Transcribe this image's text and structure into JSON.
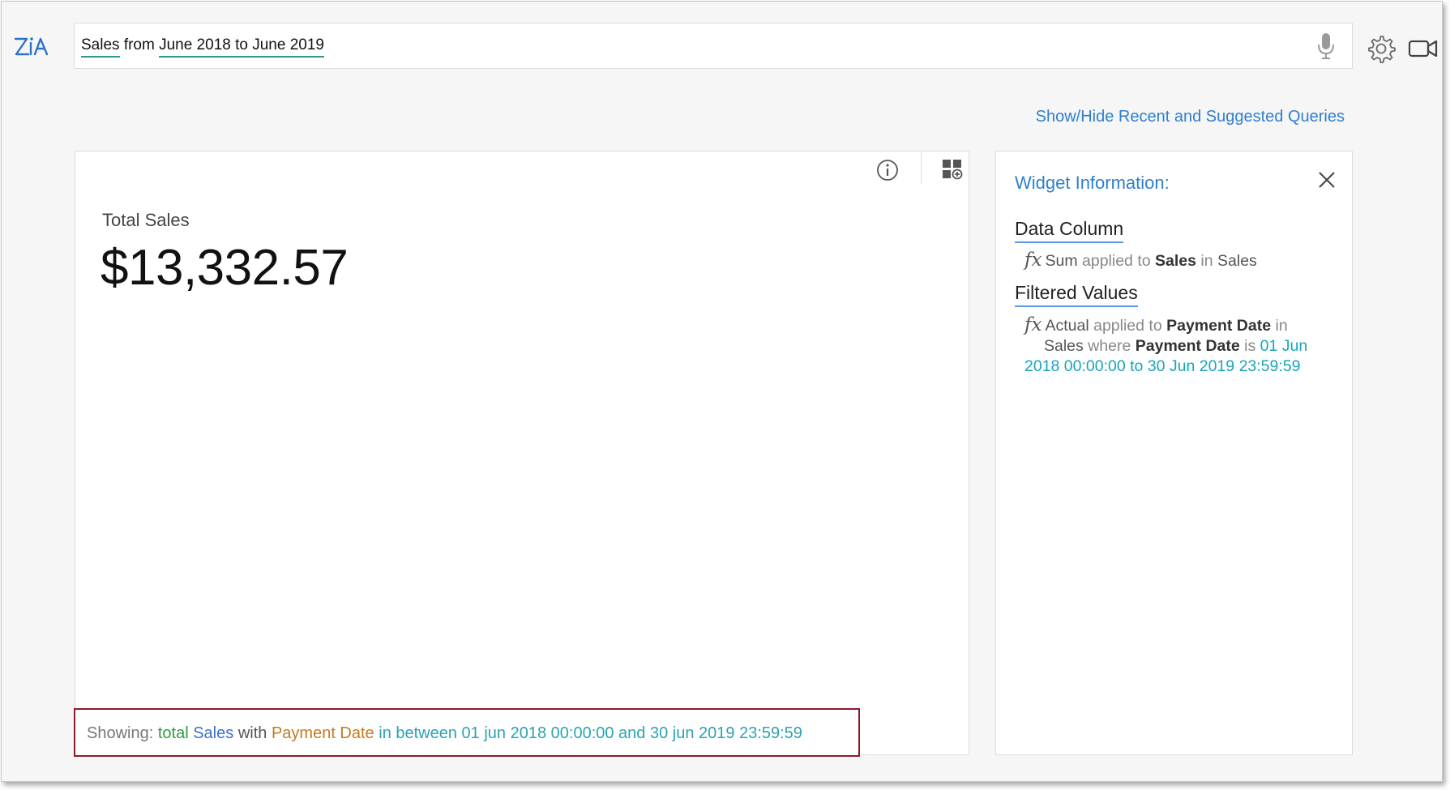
{
  "search": {
    "query_tokens": [
      "Sales",
      "from",
      "June 2018 to June 2019"
    ]
  },
  "header": {
    "suggest_link": "Show/Hide Recent and Suggested Queries"
  },
  "widget": {
    "kpi_label": "Total Sales",
    "kpi_value": "$13,332.57",
    "showing": {
      "prefix": "Showing:",
      "aggregate": "total",
      "measure": "Sales",
      "with": "with",
      "dimension": "Payment Date",
      "condition": "in between 01 jun 2018 00:00:00 and 30 jun 2019 23:59:59"
    }
  },
  "info_panel": {
    "title": "Widget Information:",
    "data_column": {
      "heading": "Data Column",
      "fx": "fx",
      "function": "Sum",
      "applied_to": "applied to",
      "column": "Sales",
      "in": "in",
      "table": "Sales"
    },
    "filtered_values": {
      "heading": "Filtered Values",
      "fx": "fx",
      "function": "Actual",
      "applied_to": "applied to",
      "column": "Payment Date",
      "in": "in",
      "table": "Sales",
      "where": "where",
      "column2": "Payment Date",
      "is": "is",
      "range": "01 Jun 2018 00:00:00 to 30 Jun 2019 23:59:59"
    }
  },
  "colors": {
    "link": "#2f7fd0",
    "highlight_border": "#8b1a2b",
    "token_underline": "#2a9a8e",
    "teal": "#18a5b8"
  },
  "icons": [
    "zia-logo",
    "mic-icon",
    "gear-icon",
    "video-icon",
    "info-icon",
    "add-widget-icon",
    "close-icon"
  ]
}
